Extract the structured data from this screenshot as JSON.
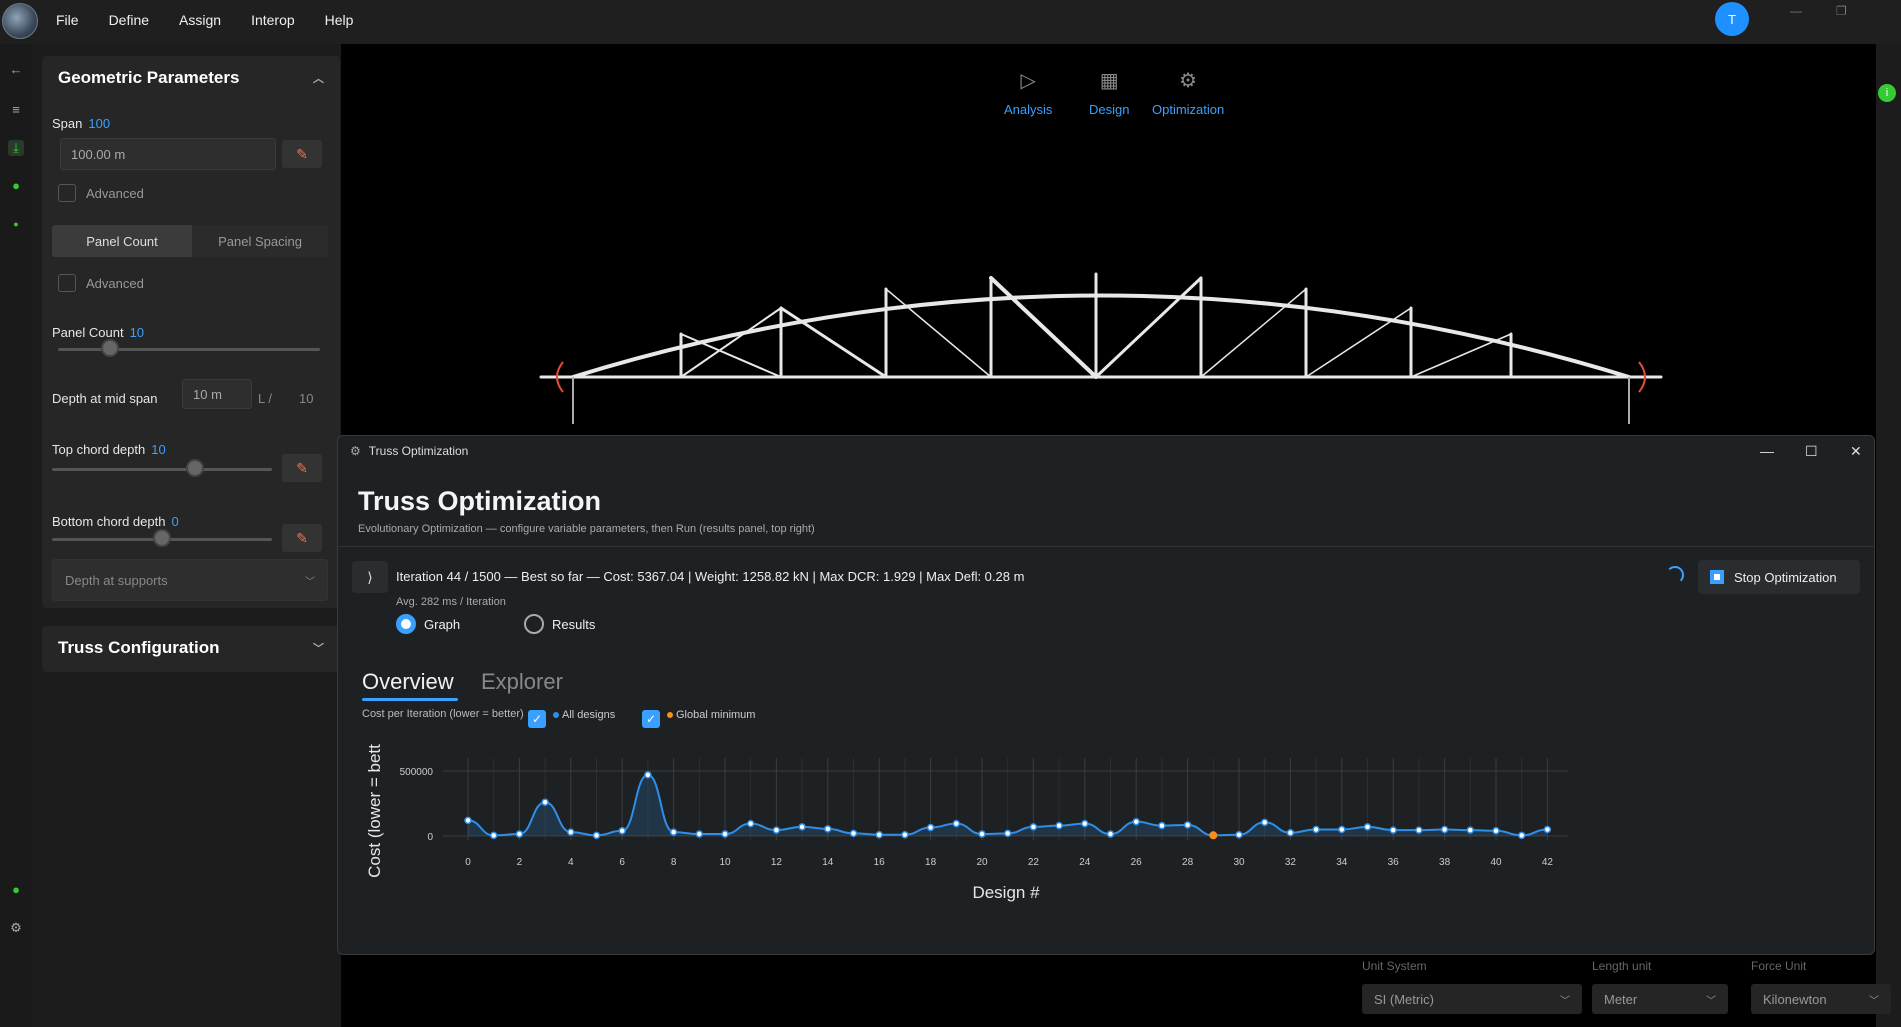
{
  "menu": [
    "File",
    "Define",
    "Assign",
    "Interop",
    "Help"
  ],
  "user_initial": "T",
  "sidebar": {
    "geometric_title": "Geometric Parameters",
    "span_label": "Span",
    "span_value": "100",
    "span_input": "100.00 m",
    "advanced_label": "Advanced",
    "panel_tabs": [
      "Panel Count",
      "Panel Spacing"
    ],
    "advanced_label2": "Advanced",
    "panel_count_label": "Panel Count",
    "panel_count_value": "10",
    "panel_count_fraction": 0.2,
    "depth_mid_label": "Depth at mid span",
    "depth_mid_input": "10 m",
    "depth_ratio_label": "L /",
    "depth_ratio_value": "10",
    "top_chord_label": "Top chord depth",
    "top_chord_value": "10",
    "top_chord_fraction": 0.65,
    "bottom_chord_label": "Bottom chord depth",
    "bottom_chord_value": "0",
    "bottom_chord_fraction": 0.5,
    "depth_supports": "Depth at supports",
    "truss_config_title": "Truss Configuration"
  },
  "modes": [
    "Analysis",
    "Design",
    "Optimization"
  ],
  "dialog": {
    "window_title": "Truss Optimization",
    "title": "Truss Optimization",
    "subtitle": "Evolutionary Optimization — configure variable parameters, then Run (results panel, top right)",
    "expander": "⟩",
    "iteration_line": "Iteration 44 / 1500  —  Best so far  —  Cost: 5367.04  |  Weight: 1258.82 kN  |  Max DCR: 1.929  |  Max Defl: 0.28 m",
    "avg_line": "Avg. 282 ms / Iteration",
    "stop_label": "Stop Optimization",
    "radio_graph": "Graph",
    "radio_results": "Results",
    "tab_overview": "Overview",
    "tab_explorer": "Explorer",
    "chart_caption": "Cost per Iteration  (lower = better)",
    "legend_all": "All designs",
    "legend_min": "Global minimum"
  },
  "units": {
    "system_label": "Unit System",
    "system_value": "SI (Metric)",
    "length_label": "Length unit",
    "length_value": "Meter",
    "force_label": "Force Unit",
    "force_value": "Kilonewton"
  },
  "colors": {
    "accent": "#3aa0ff",
    "min_marker": "#ff8c1a",
    "series": "#2e8fe8"
  },
  "chart_data": {
    "type": "line",
    "xlabel": "Design #",
    "ylabel": "Cost  (lower = bett",
    "ytick_labels": [
      "500000",
      "0"
    ],
    "yticks": [
      500000,
      0
    ],
    "xticks": [
      0,
      2,
      4,
      6,
      8,
      10,
      12,
      14,
      16,
      18,
      20,
      22,
      24,
      26,
      28,
      30,
      32,
      34,
      36,
      38,
      40,
      42
    ],
    "xlim": [
      -1,
      43
    ],
    "ylim": [
      -40000,
      560000
    ],
    "grid": true,
    "series": [
      {
        "name": "All designs",
        "x": [
          0,
          1,
          2,
          3,
          4,
          5,
          6,
          7,
          8,
          9,
          10,
          11,
          12,
          13,
          14,
          15,
          16,
          17,
          18,
          19,
          20,
          21,
          22,
          23,
          24,
          25,
          26,
          27,
          28,
          29,
          30,
          31,
          32,
          33,
          34,
          35,
          36,
          37,
          38,
          39,
          40,
          41,
          42
        ],
        "y": [
          120000,
          5000,
          15000,
          260000,
          30000,
          5000,
          40000,
          470000,
          30000,
          15000,
          15000,
          95000,
          45000,
          70000,
          55000,
          20000,
          10000,
          10000,
          65000,
          95000,
          15000,
          20000,
          70000,
          80000,
          95000,
          15000,
          110000,
          80000,
          85000,
          5000,
          10000,
          105000,
          25000,
          50000,
          50000,
          70000,
          45000,
          45000,
          50000,
          45000,
          40000,
          5000,
          50000
        ]
      },
      {
        "name": "Global minimum",
        "x": [
          29
        ],
        "y": [
          5367
        ]
      }
    ]
  }
}
